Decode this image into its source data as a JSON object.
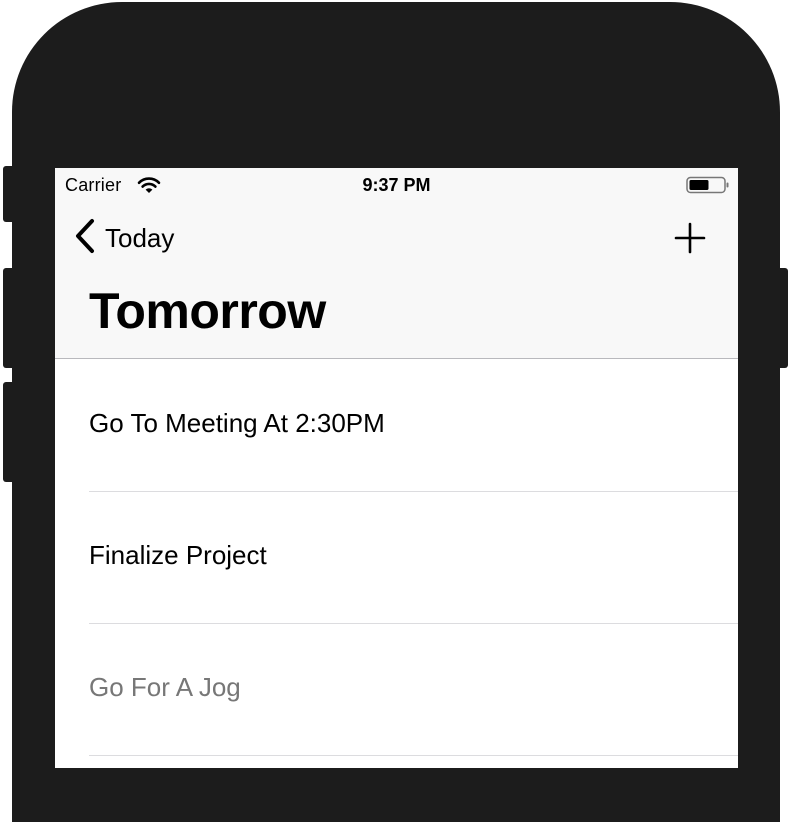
{
  "status_bar": {
    "carrier": "Carrier",
    "time": "9:37 PM",
    "wifi_icon": "wifi-icon",
    "battery_icon": "battery-icon"
  },
  "nav": {
    "back_label": "Today",
    "back_icon": "chevron-left-icon",
    "add_icon": "plus-icon",
    "title": "Tomorrow"
  },
  "items": [
    {
      "label": "Go To Meeting At 2:30PM"
    },
    {
      "label": "Finalize Project"
    },
    {
      "label": "Go For A Jog"
    }
  ],
  "colors": {
    "bar_background": "#f8f8f8",
    "device_frame": "#1c1c1c",
    "separator": "#dcdcdf",
    "dimmed_text": "#777777"
  }
}
